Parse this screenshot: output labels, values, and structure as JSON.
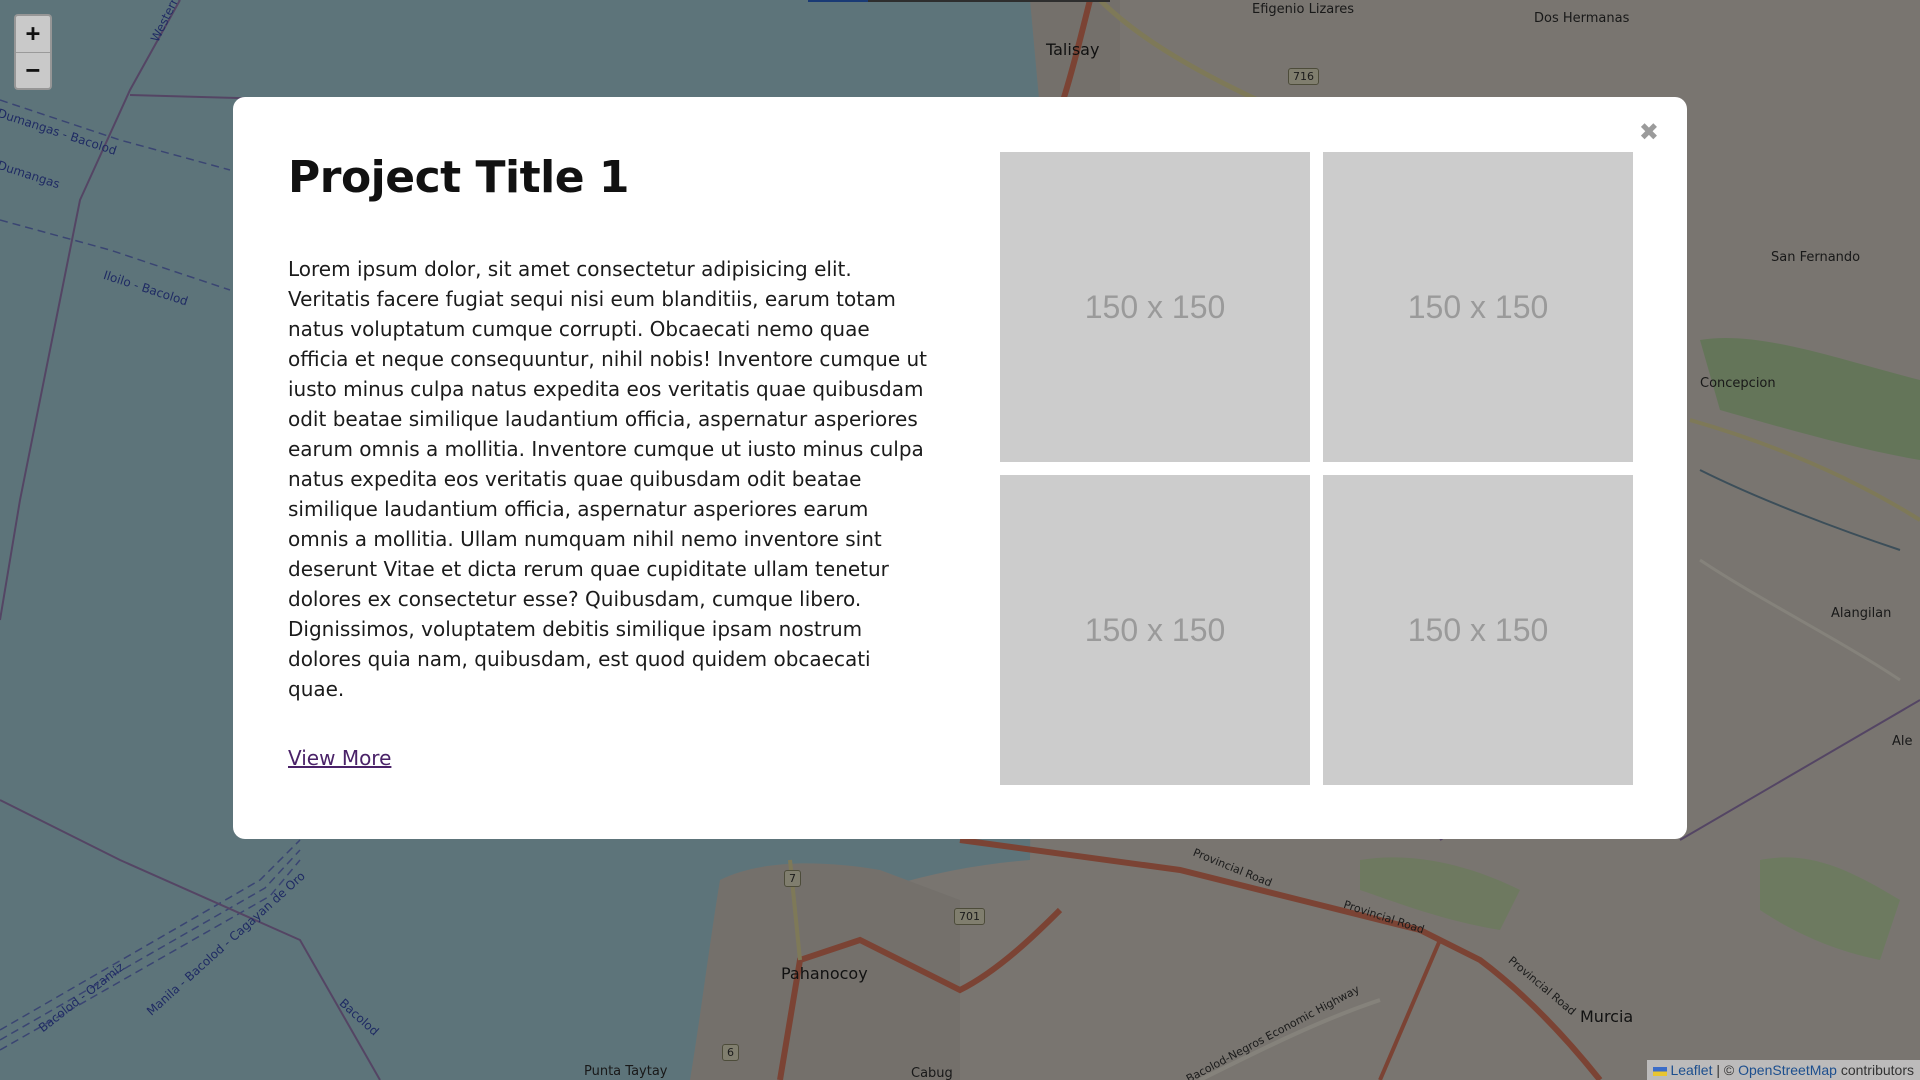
{
  "map": {
    "labels": {
      "talisay": "Talisay",
      "efigenio_lizares": "Efigenio Lizares",
      "dos_hermanas": "Dos Hermanas",
      "san_fernando": "San Fernando",
      "concepcion": "Concepcion",
      "alangilan": "Alangilan",
      "alegria": "Ale",
      "pahanocoy": "Pahanocoy",
      "murcia": "Murcia",
      "punta_taytay": "Punta Taytay",
      "cabug": "Cabug",
      "route_dumangas_bacolod": "Dumangas - Bacolod",
      "route_iloilo_bacolod": "Iloilo - Bacolod",
      "route_manila_bacolod": "Manila - Bacolod - Cagayan de Oro",
      "route_bacolod_ozamiz": "Bacolod - Ozamiz",
      "route_western": "Western",
      "route_dumangas": "Dumangas",
      "route_bacolod": "Bacolod",
      "provincial_road": "Provincial Road",
      "economic_highway": "Bacolod-Negros Economic Highway"
    },
    "shields": {
      "s716": "716",
      "s701": "701",
      "s7": "7",
      "s6": "6"
    }
  },
  "controls": {
    "zoom_in": "+",
    "zoom_out": "−"
  },
  "attribution": {
    "leaflet": "Leaflet",
    "separator": " | © ",
    "osm": "OpenStreetMap",
    "contributors": " contributors"
  },
  "modal": {
    "close_glyph": "✖",
    "title": "Project Title 1",
    "description": "Lorem ipsum dolor, sit amet consectetur adipisicing elit. Veritatis facere fugiat sequi nisi eum blanditiis, earum totam natus voluptatum cumque corrupti. Obcaecati nemo quae officia et neque consequuntur, nihil nobis! Inventore cumque ut iusto minus culpa natus expedita eos veritatis quae quibusdam odit beatae similique laudantium officia, aspernatur asperiores earum omnis a mollitia. Inventore cumque ut iusto minus culpa natus expedita eos veritatis quae quibusdam odit beatae similique laudantium officia, aspernatur asperiores earum omnis a mollitia. Ullam numquam nihil nemo inventore sint deserunt Vitae et dicta rerum quae cupiditate ullam tenetur dolores ex consectetur esse? Quibusdam, cumque libero. Dignissimos, voluptatem debitis similique ipsam nostrum dolores quia nam, quibusdam, est quod quidem obcaecati quae.",
    "view_more": "View More",
    "gallery": [
      "150 x 150",
      "150 x 150",
      "150 x 150",
      "150 x 150"
    ]
  },
  "colors": {
    "overlay": "rgba(0,0,0,0.45)",
    "thumb_bg": "#cccccc",
    "link": "#4a2268"
  }
}
